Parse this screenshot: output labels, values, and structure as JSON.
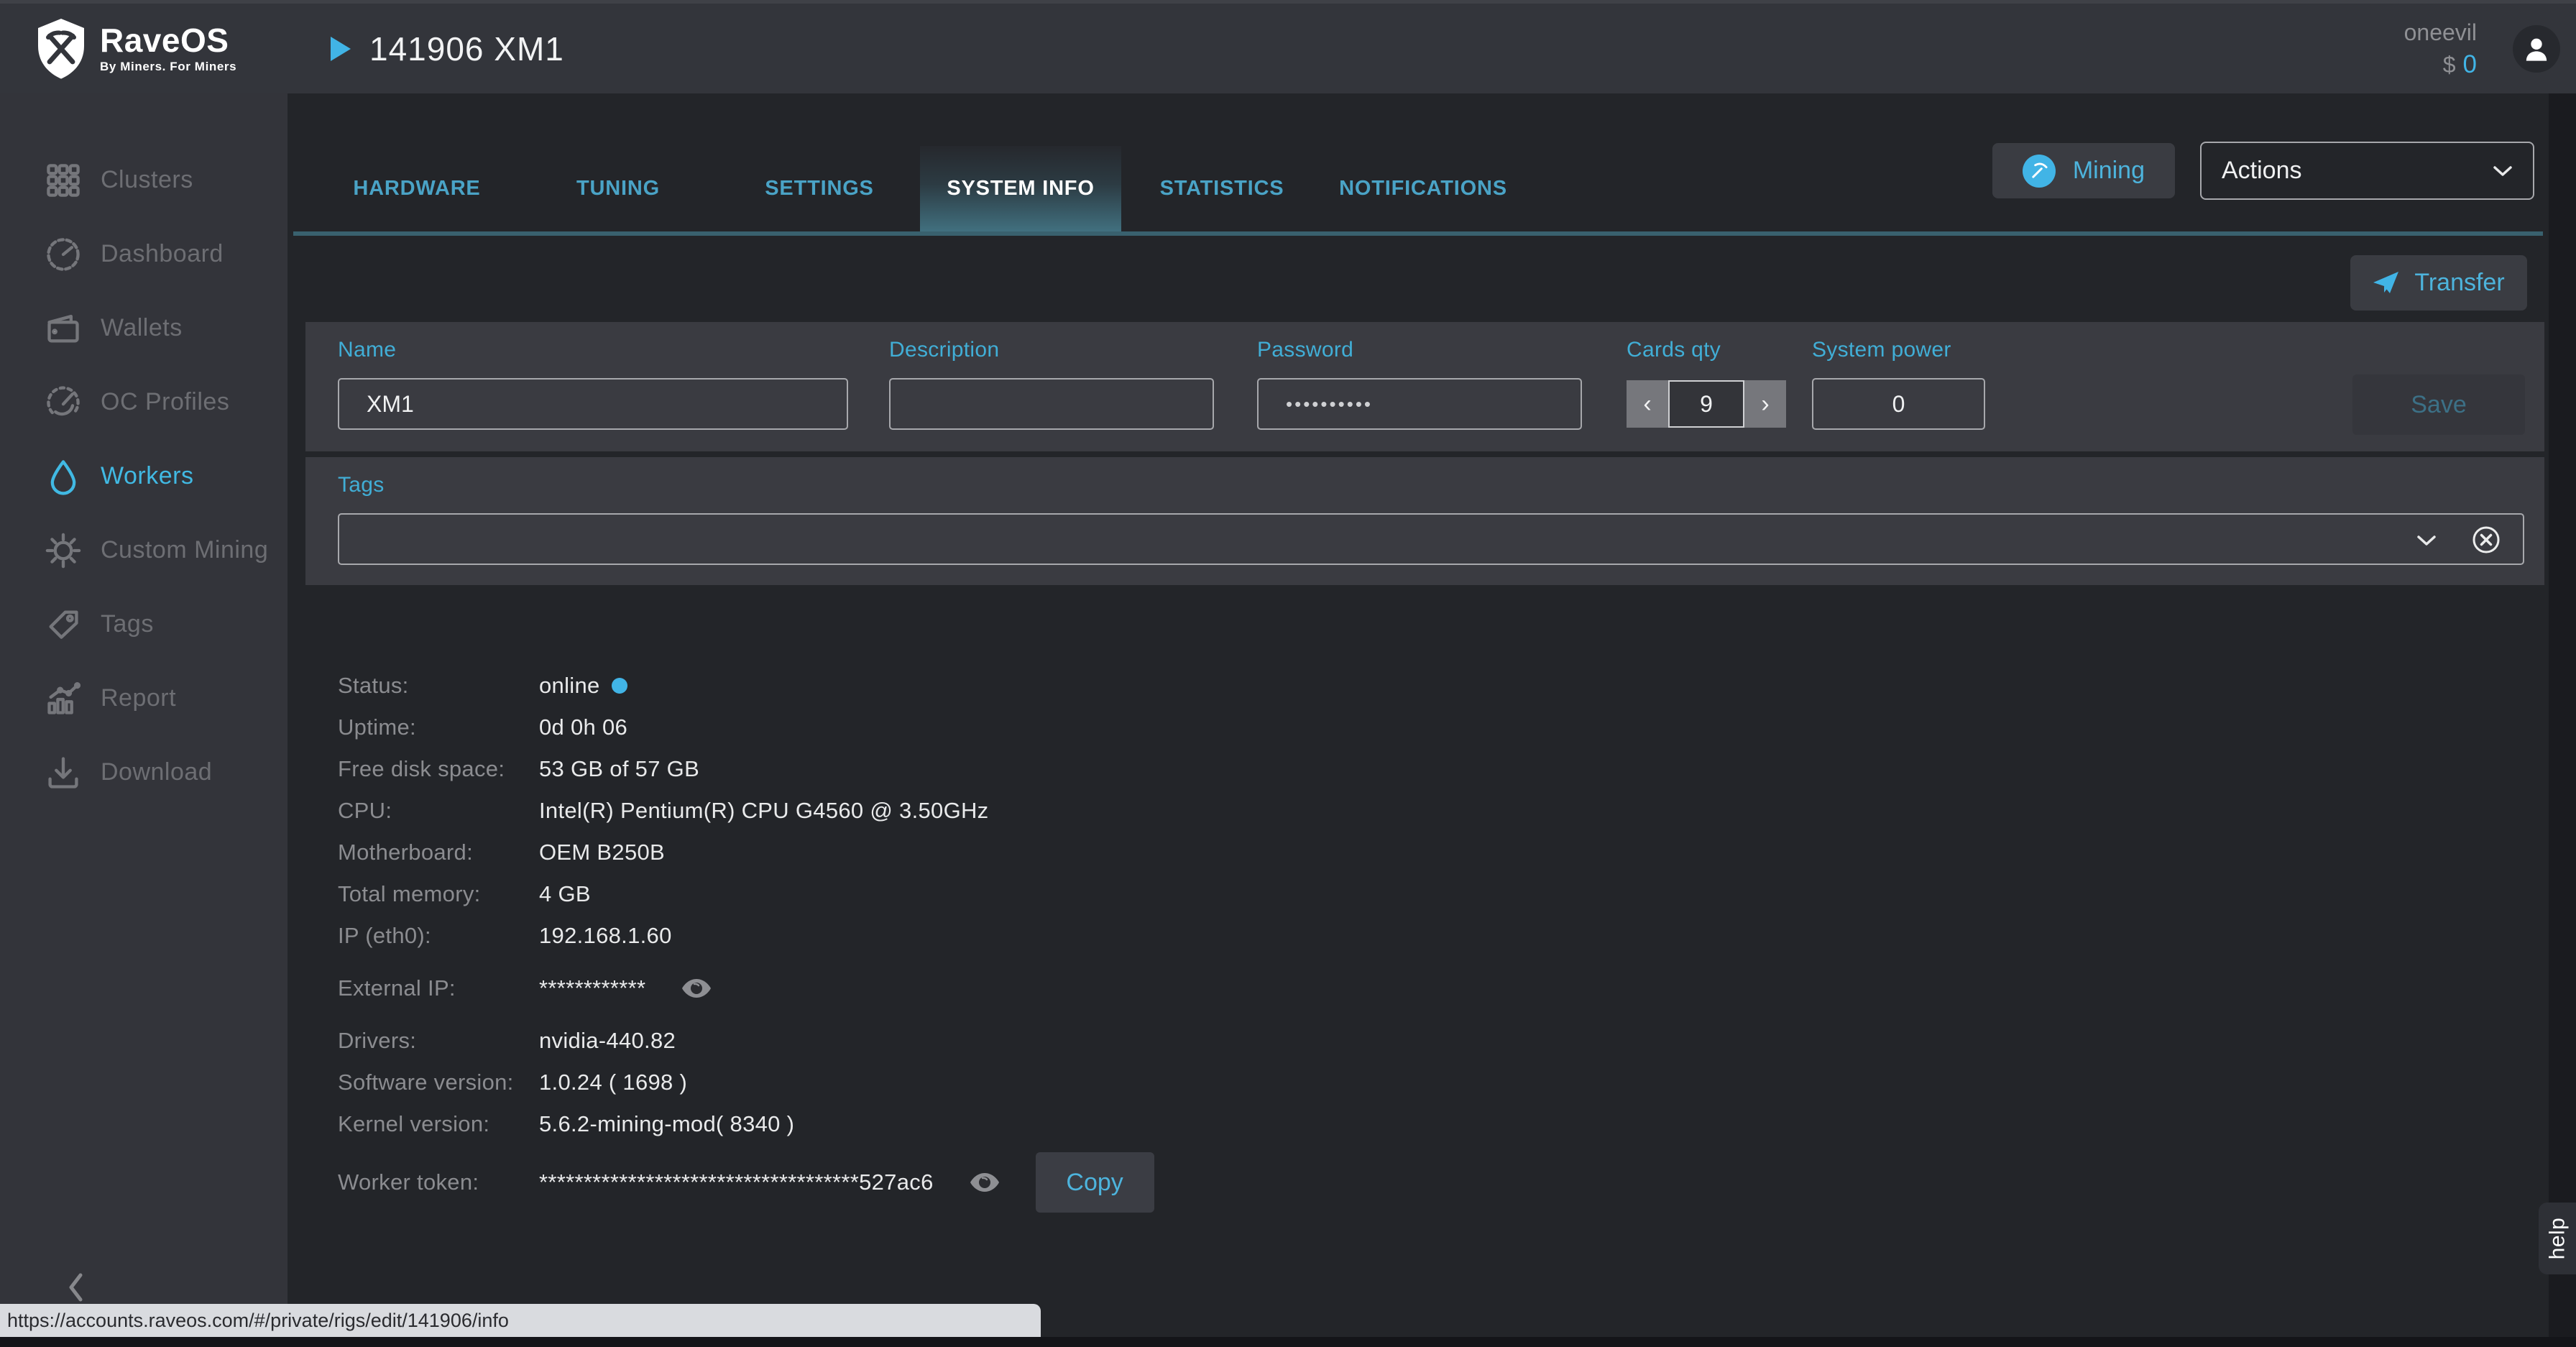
{
  "colors": {
    "accent": "#41b4e6",
    "tab_text": "#4aa3c6",
    "tab_underline": "#39616e",
    "panel_bg": "#3a3b41",
    "sidebar_bg": "#33343a",
    "main_bg": "#232529",
    "online": "#41b4e6"
  },
  "header": {
    "logo_title": "RaveOS",
    "logo_subtitle": "By Miners. For Miners",
    "worker_title": "141906 XM1",
    "username": "oneevil",
    "currency_symbol": "$",
    "balance": "0"
  },
  "sidebar": {
    "items": [
      {
        "label": "Clusters",
        "icon": "grid-icon",
        "active": false
      },
      {
        "label": "Dashboard",
        "icon": "gauge-icon",
        "active": false
      },
      {
        "label": "Wallets",
        "icon": "wallet-icon",
        "active": false
      },
      {
        "label": "OC Profiles",
        "icon": "gauge-dash-icon",
        "active": false
      },
      {
        "label": "Workers",
        "icon": "drop-icon",
        "active": true
      },
      {
        "label": "Custom Mining",
        "icon": "gear-icon",
        "active": false
      },
      {
        "label": "Tags",
        "icon": "tag-icon",
        "active": false
      },
      {
        "label": "Report",
        "icon": "chart-icon",
        "active": false
      },
      {
        "label": "Download",
        "icon": "download-icon",
        "active": false
      }
    ]
  },
  "tabs": [
    {
      "label": "HARDWARE",
      "active": false
    },
    {
      "label": "TUNING",
      "active": false
    },
    {
      "label": "SETTINGS",
      "active": false
    },
    {
      "label": "SYSTEM INFO",
      "active": true
    },
    {
      "label": "STATISTICS",
      "active": false
    },
    {
      "label": "NOTIFICATIONS",
      "active": false
    }
  ],
  "toolbar": {
    "mining_label": "Mining",
    "actions_label": "Actions",
    "transfer_label": "Transfer"
  },
  "form": {
    "name": {
      "label": "Name",
      "value": "XM1"
    },
    "description": {
      "label": "Description",
      "value": ""
    },
    "password": {
      "label": "Password",
      "value": "••••••••••"
    },
    "cards_qty": {
      "label": "Cards qty",
      "value": "9",
      "decrement": "‹",
      "increment": "›"
    },
    "system_power": {
      "label": "System power",
      "value": "0"
    },
    "save_label": "Save"
  },
  "tags": {
    "label": "Tags",
    "value": ""
  },
  "system_info": {
    "rows": [
      {
        "label": "Status:",
        "value": "online",
        "online_dot": true
      },
      {
        "label": "Uptime:",
        "value": "0d 0h 06"
      },
      {
        "label": "Free disk space:",
        "value": "53 GB of 57 GB"
      },
      {
        "label": "CPU:",
        "value": "Intel(R) Pentium(R) CPU G4560 @ 3.50GHz"
      },
      {
        "label": "Motherboard:",
        "value": "OEM B250B"
      },
      {
        "label": "Total memory:",
        "value": "4 GB"
      },
      {
        "label": "IP (eth0):",
        "value": "192.168.1.60"
      },
      {
        "label": "External IP:",
        "value": "************",
        "eye": true,
        "gap_before": true
      },
      {
        "label": "Drivers:",
        "value": "nvidia-440.82",
        "gap_before": true
      },
      {
        "label": "Software version:",
        "value": "1.0.24 ( 1698 )"
      },
      {
        "label": "Kernel version:",
        "value": "5.6.2-mining-mod( 8340 )"
      },
      {
        "label": "Worker token:",
        "value": "************************************527ac6",
        "eye": true,
        "copy_label": "Copy",
        "tall": true
      }
    ]
  },
  "help_tab_label": "help",
  "status_bar_url": "https://accounts.raveos.com/#/private/rigs/edit/141906/info"
}
